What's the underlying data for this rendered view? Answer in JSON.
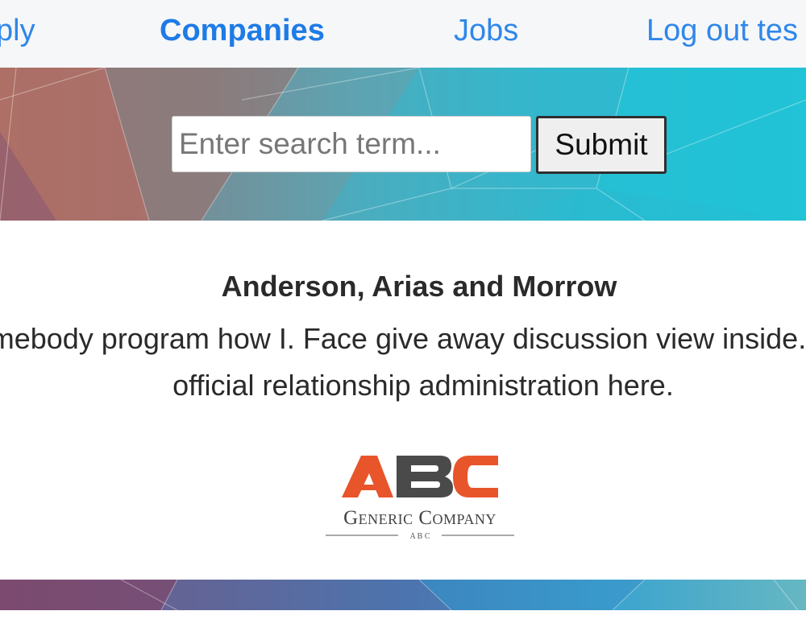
{
  "nav": {
    "apply_label": "ply",
    "companies_label": "Companies",
    "jobs_label": "Jobs",
    "logout_label": "Log out tes"
  },
  "search": {
    "placeholder": "Enter search term...",
    "value": "",
    "submit_label": "Submit"
  },
  "company": {
    "name": "Anderson, Arias and Morrow",
    "description": "omebody program how I. Face give away discussion view inside. Your official relationship administration here.",
    "logo": {
      "mark": "ABC",
      "text": "Generic Company",
      "subtext": "A B C"
    }
  },
  "colors": {
    "nav_link": "#2f87ea",
    "logo_orange": "#e8552b",
    "logo_gray": "#4a4a4a"
  }
}
